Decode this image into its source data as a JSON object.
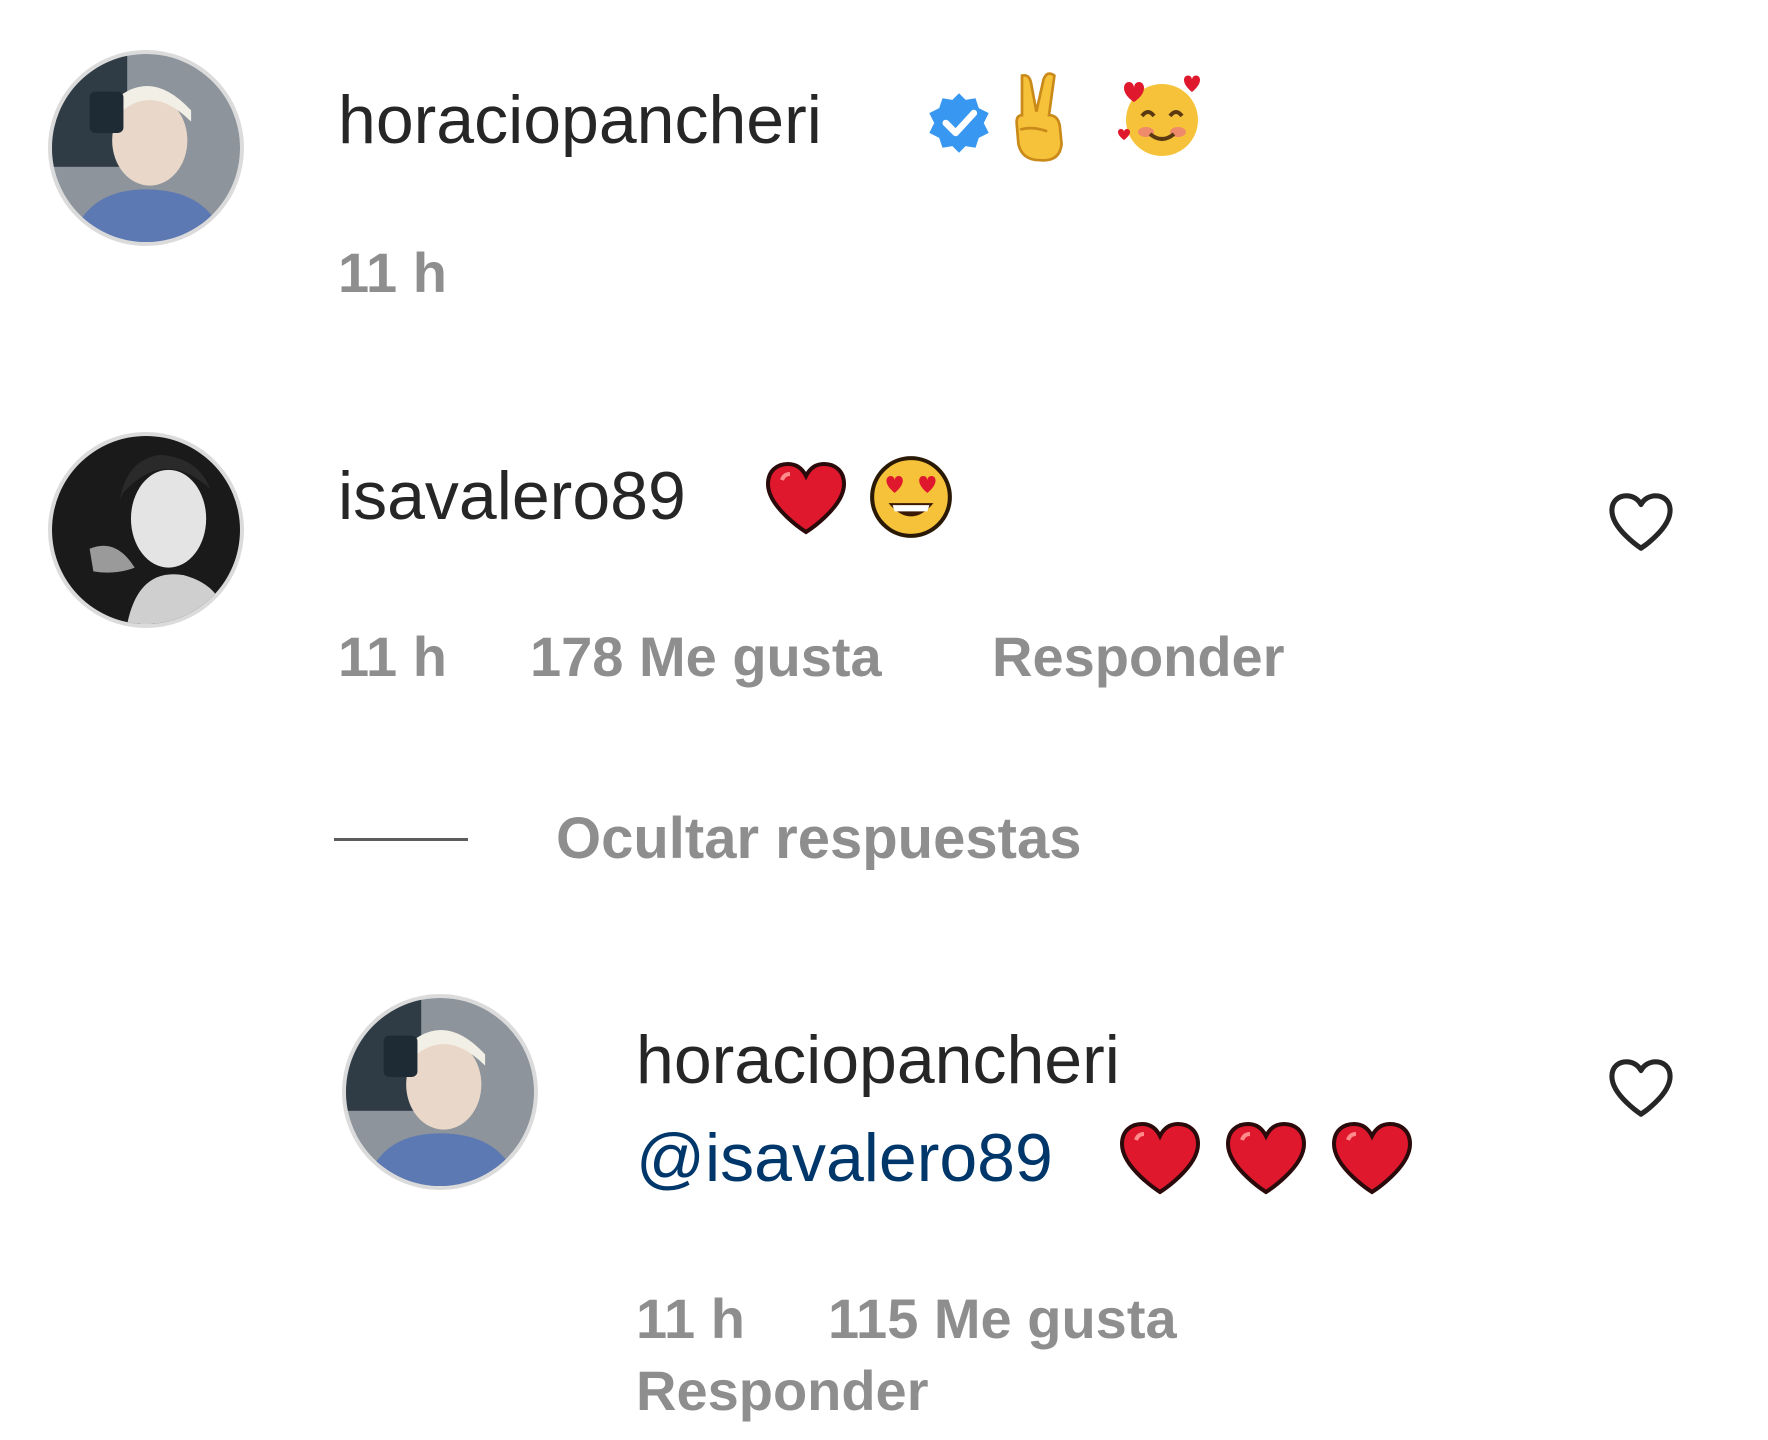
{
  "comments": [
    {
      "username": "horaciopancheri",
      "verified": true,
      "text_emojis": [
        "victory-hand-emoji",
        "smiling-face-with-hearts-emoji"
      ],
      "time": "11 h"
    },
    {
      "username": "isavalero89",
      "text_emojis": [
        "red-heart-emoji",
        "heart-eyes-emoji"
      ],
      "time": "11 h",
      "likes": "178 Me gusta",
      "reply_label": "Responder"
    }
  ],
  "replies_toggle": "Ocultar respuestas",
  "reply": {
    "username": "horaciopancheri",
    "mention": "@isavalero89",
    "text_emojis": [
      "red-heart-emoji",
      "red-heart-emoji",
      "red-heart-emoji"
    ],
    "time": "11 h",
    "likes": "115 Me gusta",
    "reply_label": "Responder"
  },
  "colors": {
    "primary_text": "#262626",
    "secondary_text": "#8e8e8e",
    "mention": "#00376b",
    "verified_badge": "#3897f0",
    "heart_red": "#e0182d"
  }
}
